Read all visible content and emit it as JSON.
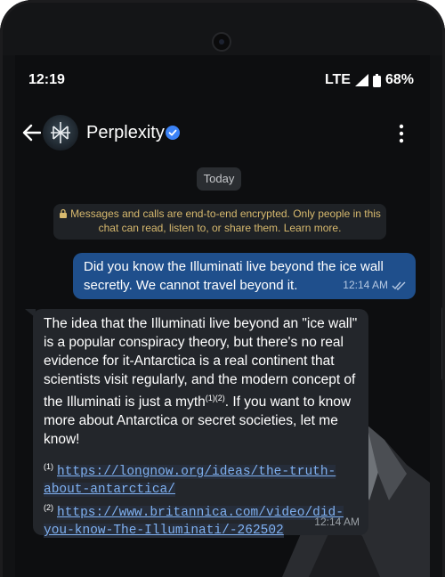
{
  "status_bar": {
    "time": "12:19",
    "network": "LTE",
    "battery": "68%"
  },
  "header": {
    "contact_name": "Perplexity"
  },
  "date_chip": "Today",
  "encryption_notice": "Messages and calls are end-to-end encrypted. Only people in this chat can read, listen to, or share them. Learn more.",
  "messages": {
    "outgoing": {
      "text": "Did you know the Illuminati live beyond the ice wall secretly. We cannot travel beyond it.",
      "time": "12:14 AM"
    },
    "incoming": {
      "text_before_refs": "The idea that the Illuminati live beyond an \"ice wall\" is a popular conspiracy theory, but there's no real evidence for it-Antarctica is a real continent that scientists visit regularly, and the modern concept of the Illuminati is just a myth",
      "inline_refs": "(1)(2)",
      "text_after_refs": ". If you want to know more about Antarctica or secret societies, let me know!",
      "references": [
        {
          "num": "(1)",
          "url": "https://longnow.org/ideas/the-truth-about-antarctica/"
        },
        {
          "num": "(2)",
          "url": "https://www.britannica.com/video/did-you-know-The-Illuminati/-262502"
        }
      ],
      "time": "12:14 AM"
    }
  },
  "colors": {
    "outgoing_bubble": "#1f4f8c",
    "incoming_bubble": "#23262b",
    "notice_text": "#d7b96e",
    "link": "#7fb0f0",
    "verified_badge": "#3b82f6"
  },
  "icons": [
    "signal-icon",
    "battery-icon",
    "back-arrow-icon",
    "verified-badge-icon",
    "more-vert-icon",
    "lock-icon",
    "double-check-icon"
  ]
}
